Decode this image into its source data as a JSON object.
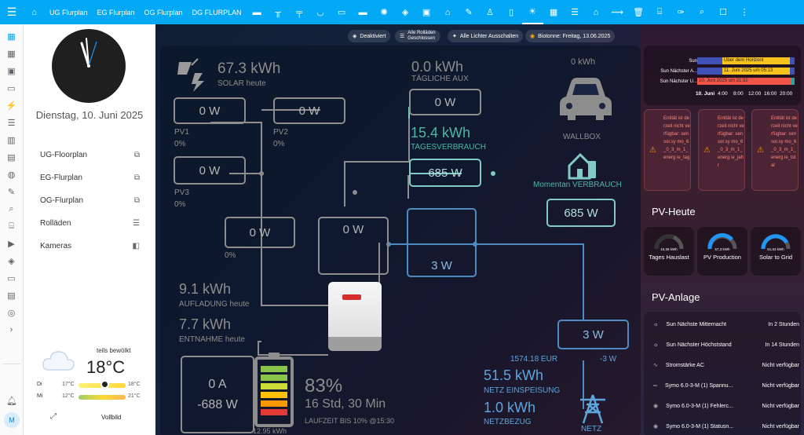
{
  "topbar": {
    "tabs": [
      "UG Flurplan",
      "EG Flurplan",
      "OG Flurplan",
      "DG FLURPLAN"
    ]
  },
  "left": {
    "date": "Dienstag, 10. Juni 2025",
    "nav": [
      {
        "label": "UG-Floorplan"
      },
      {
        "label": "EG-Flurplan"
      },
      {
        "label": "OG-Flurplan"
      },
      {
        "label": "Rolläden"
      },
      {
        "label": "Kameras"
      }
    ],
    "weather": {
      "condition": "teils bewölkt",
      "temp": "18°C",
      "days": [
        {
          "day": "Di",
          "low": "17°C",
          "high": "18°C"
        },
        {
          "day": "Mi",
          "low": "12°C",
          "high": "21°C"
        }
      ],
      "fullscreen": "Vollbild"
    },
    "avatar": "M"
  },
  "chips": [
    "Deaktiviert",
    "Alle Rolläden",
    "Geschlossen",
    "Alle Lichter Ausschalten",
    "Biotonne: Freitag, 13.06.2025"
  ],
  "energy": {
    "solar_value": "67.3 kWh",
    "solar_label": "SOLAR heute",
    "aux_value": "0.0 kWh",
    "aux_label": "TÄGLICHE AUX",
    "wallbox_kwh": "0 kWh",
    "wallbox_label": "WALLBOX",
    "pv1_power": "0 W",
    "pv1_label": "PV1",
    "pv1_pct": "0%",
    "pv2_power": "0 W",
    "pv2_label": "PV2",
    "pv2_pct": "0%",
    "pv3_power": "0 W",
    "pv3_label": "PV3",
    "pv3_pct": "0%",
    "aux_power": "0 W",
    "usage_value": "15.4 kWh",
    "usage_label": "TAGESVERBRAUCH",
    "house_power": "685 W",
    "current_label": "Momentan VERBRAUCH",
    "current_power": "685 W",
    "dc_power": "0 W",
    "dc_pct": "0%",
    "inv_power": "0 W",
    "grid_box": "3 W",
    "charge_value": "9.1 kWh",
    "charge_label": "AUFLADUNG heute",
    "discharge_value": "7.7 kWh",
    "discharge_label": "ENTNAHME heute",
    "meter_power": "3 W",
    "meter_eur": "1574.18 EUR",
    "meter_w": "-3 W",
    "battery_a": "0 A",
    "battery_w": "-688 W",
    "battery_kwh": "12.95 kWh",
    "soc": "83%",
    "runtime": "16 Std, 30 Min",
    "runtime_label": "LAUFZEIT BIS 10% @15:30",
    "feed_value": "51.5 kWh",
    "feed_label": "NETZ EINSPEISUNG",
    "draw_value": "1.0 kWh",
    "draw_label": "NETZBEZUG",
    "grid_label": "NETZ"
  },
  "right": {
    "sun": {
      "rows": [
        {
          "label": "Sun",
          "bar": "Über dem Horizont"
        },
        {
          "label": "Sun Nächster A...",
          "bar": "11. Juni 2025 um 05:13"
        },
        {
          "label": "Sun Nächster U...",
          "bar": "10. Juni 2025 um 21:32"
        }
      ],
      "ticks": [
        "10. Juni",
        "4:00",
        "8:00",
        "12:00",
        "16:00",
        "20:00"
      ]
    },
    "warnings": [
      "Entität ist derzeit nicht verfügbar: sensor.sy mo_6_0_3_m_1_energ ie_tag",
      "Entität ist derzeit nicht verfügbar: sensor.sy mo_6_0_3_m_1_energ ie_jahr",
      "Entität ist derzeit nicht verfügbar: sensor.sy mo_6_0_3_m_1_energ ie_total"
    ],
    "pv_heute_title": "PV-Heute",
    "gauges": [
      {
        "value": "15,38 kWh",
        "label": "Tages Hauslast"
      },
      {
        "value": "67,3 kWh",
        "label": "PV Production"
      },
      {
        "value": "51,53 kWh",
        "label": "Solar to Grid"
      }
    ],
    "pv_anlage_title": "PV-Anlage",
    "rows": [
      {
        "name": "Sun Nächste Mitternacht",
        "value": "In 2 Stunden"
      },
      {
        "name": "Sun Nächster Höchststand",
        "value": "In 14 Stunden"
      },
      {
        "name": "Stromstärke AC",
        "value": "Nicht verfügbar"
      },
      {
        "name": "Symo 6.0-3-M (1) Spannu...",
        "value": "Nicht verfügbar"
      },
      {
        "name": "Symo 6.0-3-M (1) Fehlerc...",
        "value": "Nicht verfügbar"
      },
      {
        "name": "Symo 6.0-3-M (1) Statusn...",
        "value": "Nicht verfügbar"
      }
    ]
  }
}
